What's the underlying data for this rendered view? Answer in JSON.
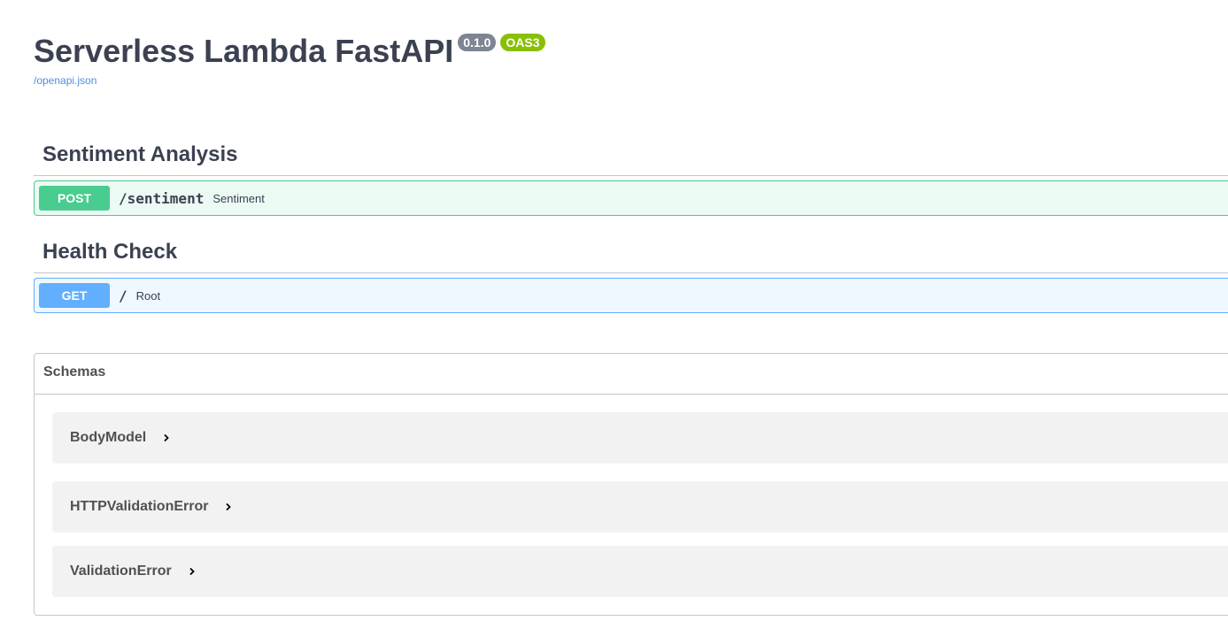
{
  "info": {
    "title": "Serverless Lambda FastAPI",
    "version": "0.1.0",
    "oas_badge": "OAS3",
    "spec_link": "/openapi.json"
  },
  "tags": [
    {
      "name": "Sentiment Analysis",
      "operations": [
        {
          "method": "POST",
          "path": "/sentiment",
          "summary": "Sentiment"
        }
      ]
    },
    {
      "name": "Health Check",
      "operations": [
        {
          "method": "GET",
          "path": "/",
          "summary": "Root"
        }
      ]
    }
  ],
  "schemas": {
    "label": "Schemas",
    "items": [
      {
        "name": "BodyModel",
        "icon": "chevron-right-icon"
      },
      {
        "name": "HTTPValidationError",
        "icon": "chevron-right-icon"
      },
      {
        "name": "ValidationError",
        "icon": "chevron-right-icon"
      }
    ]
  },
  "colors": {
    "post": "#49cc90",
    "get": "#61affe",
    "version_badge": "#7d8492",
    "oas_badge": "#89bf04",
    "link": "#4990e2",
    "text": "#3b4151"
  }
}
